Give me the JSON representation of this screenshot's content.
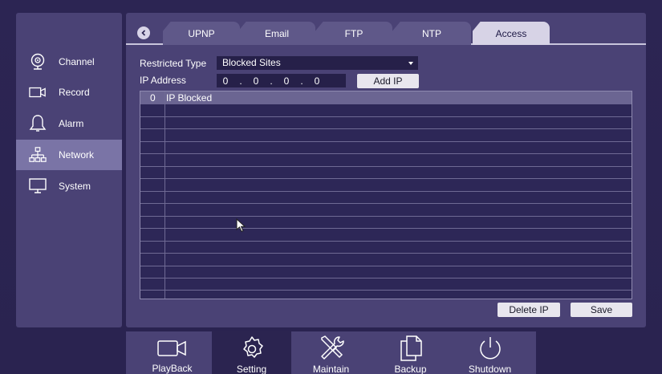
{
  "sidebar": {
    "items": [
      {
        "label": "Channel",
        "icon": "webcam-icon"
      },
      {
        "label": "Record",
        "icon": "video-camera-icon"
      },
      {
        "label": "Alarm",
        "icon": "bell-icon"
      },
      {
        "label": "Network",
        "icon": "network-icon",
        "active": true
      },
      {
        "label": "System",
        "icon": "monitor-icon"
      }
    ]
  },
  "tabs": [
    {
      "label": "UPNP"
    },
    {
      "label": "Email"
    },
    {
      "label": "FTP"
    },
    {
      "label": "NTP"
    },
    {
      "label": "Access",
      "active": true
    }
  ],
  "form": {
    "restricted_type_label": "Restricted Type",
    "restricted_type_value": "Blocked Sites",
    "ip_address_label": "IP Address",
    "ip_octets": [
      "0",
      "0",
      "0",
      "0"
    ],
    "ip_separator": ".",
    "add_ip_label": "Add IP"
  },
  "table": {
    "count": "0",
    "column_header": "IP Blocked",
    "rows": []
  },
  "actions": {
    "delete_ip_label": "Delete IP",
    "save_label": "Save"
  },
  "bottombar": {
    "items": [
      {
        "label": "PlayBack",
        "icon": "video-camera-icon"
      },
      {
        "label": "Setting",
        "icon": "gear-icon",
        "active": true
      },
      {
        "label": "Maintain",
        "icon": "tools-icon"
      },
      {
        "label": "Backup",
        "icon": "copy-icon"
      },
      {
        "label": "Shutdown",
        "icon": "power-icon"
      }
    ]
  },
  "colors": {
    "background": "#2a2350",
    "panel": "#4a4275",
    "active_sidebar": "#7a74a6",
    "active_tab": "#d7d3e6",
    "table_bg": "#2d2757"
  }
}
